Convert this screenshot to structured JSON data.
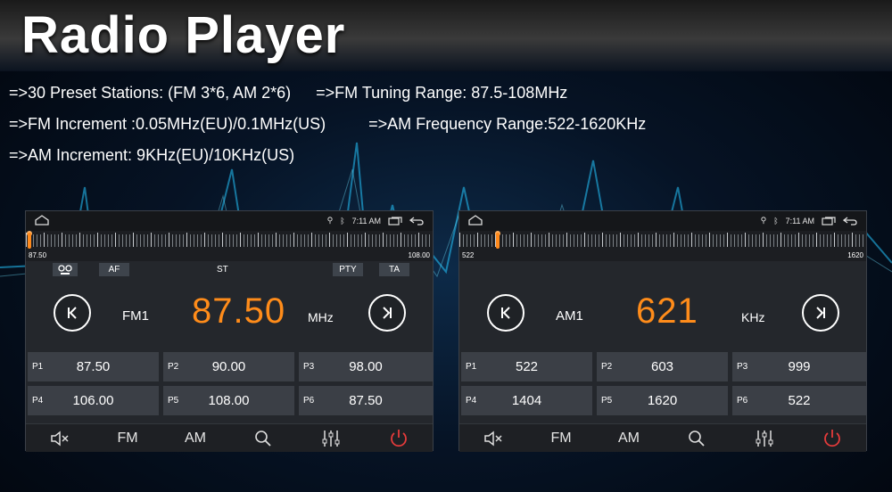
{
  "page": {
    "title": "Radio Player",
    "specs": [
      [
        "=>30 Preset Stations: (FM 3*6, AM 2*6)",
        "=>FM Tuning Range: 87.5-108MHz"
      ],
      [
        "=>FM Increment :0.05MHz(EU)/0.1MHz(US)",
        "=>AM Frequency Range:522-1620KHz"
      ],
      [
        "=>AM Increment: 9KHz(EU)/10KHz(US)"
      ]
    ]
  },
  "colors": {
    "accent": "#ff8c1a",
    "power": "#e53b3b",
    "panel": "#24272c",
    "preset_bg": "#3b3f46"
  },
  "screens": [
    {
      "status_time": "7:11 AM",
      "tuner": {
        "min": "87.50",
        "max": "108.00",
        "position": 0.0
      },
      "tags": {
        "rds_icon": "rds-icon",
        "af": "AF",
        "st": "ST",
        "pty": "PTY",
        "ta": "TA"
      },
      "band": "FM1",
      "frequency": "87.50",
      "unit": "MHz",
      "presets": [
        {
          "label": "P1",
          "value": "87.50"
        },
        {
          "label": "P2",
          "value": "90.00"
        },
        {
          "label": "P3",
          "value": "98.00"
        },
        {
          "label": "P4",
          "value": "106.00"
        },
        {
          "label": "P5",
          "value": "108.00"
        },
        {
          "label": "P6",
          "value": "87.50"
        }
      ],
      "toolbar": {
        "mute_icon": "mute-icon",
        "fm": "FM",
        "am": "AM",
        "search_icon": "search-icon",
        "eq_icon": "equalizer-icon",
        "power_icon": "power-icon"
      }
    },
    {
      "status_time": "7:11 AM",
      "tuner": {
        "min": "522",
        "max": "1620",
        "position": 0.09
      },
      "band": "AM1",
      "frequency": "621",
      "unit": "KHz",
      "presets": [
        {
          "label": "P1",
          "value": "522"
        },
        {
          "label": "P2",
          "value": "603"
        },
        {
          "label": "P3",
          "value": "999"
        },
        {
          "label": "P4",
          "value": "1404"
        },
        {
          "label": "P5",
          "value": "1620"
        },
        {
          "label": "P6",
          "value": "522"
        }
      ],
      "toolbar": {
        "mute_icon": "mute-icon",
        "fm": "FM",
        "am": "AM",
        "search_icon": "search-icon",
        "eq_icon": "equalizer-icon",
        "power_icon": "power-icon"
      }
    }
  ]
}
